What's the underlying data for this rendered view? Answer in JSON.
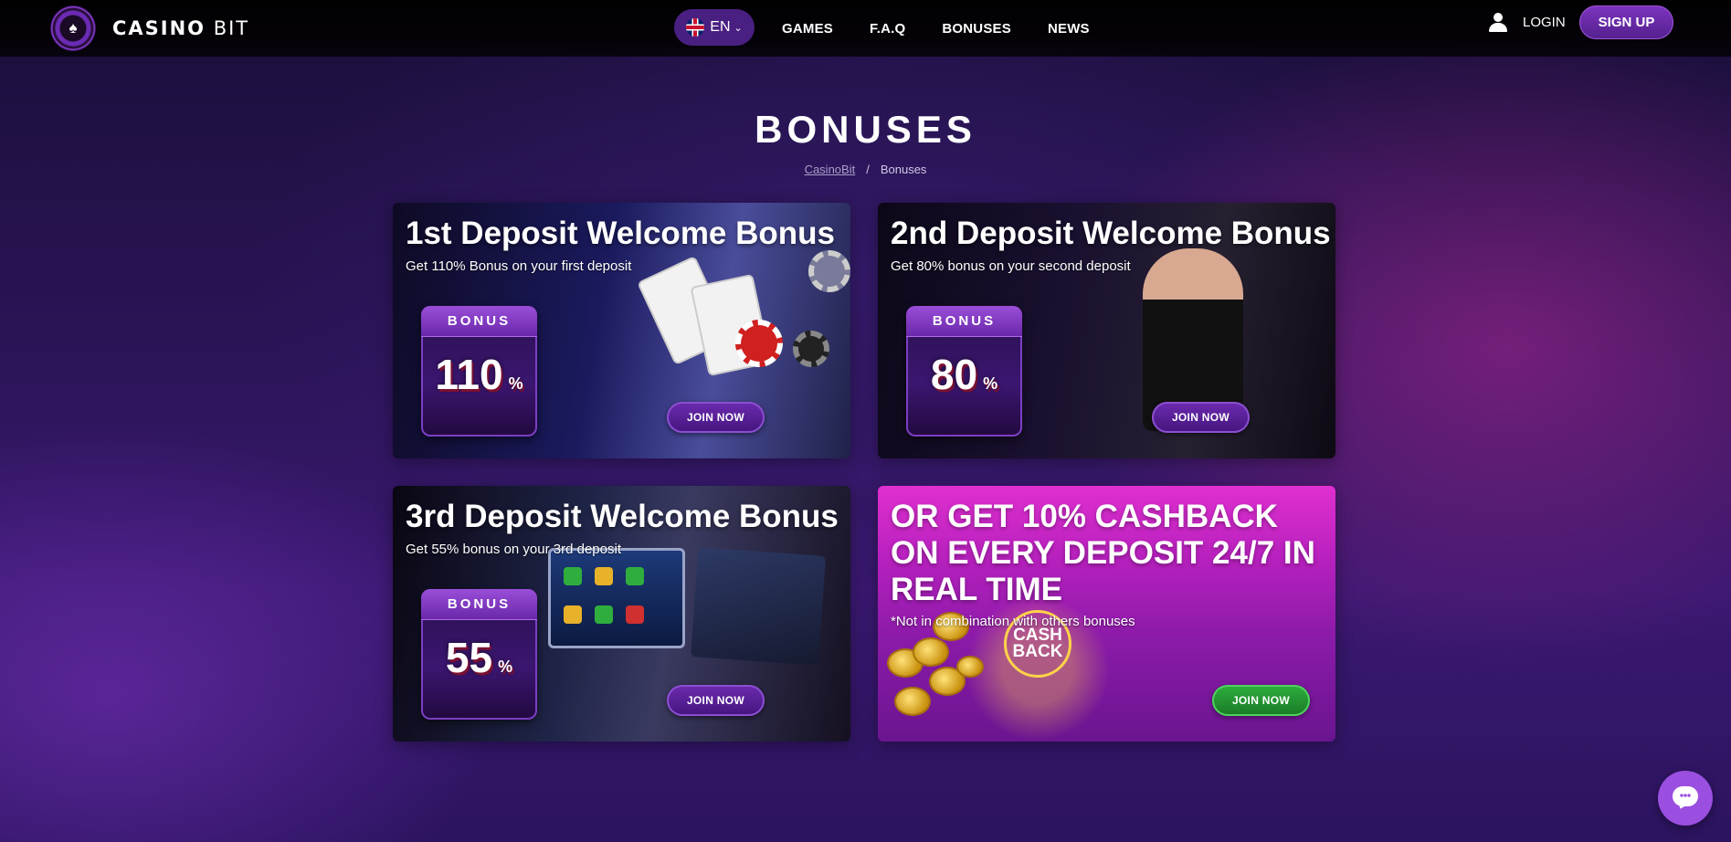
{
  "header": {
    "logo_text_bold": "CASINO",
    "logo_text_rest": " BIT",
    "language": "EN",
    "nav": [
      {
        "label": "GAMES"
      },
      {
        "label": "F.A.Q"
      },
      {
        "label": "BONUSES"
      },
      {
        "label": "NEWS"
      }
    ],
    "login_label": "LOGIN",
    "signup_label": "SIGN UP"
  },
  "page": {
    "title": "BONUSES",
    "breadcrumb": {
      "home": "CasinoBit",
      "separator": "/",
      "current": "Bonuses"
    }
  },
  "cards": [
    {
      "title": "1st Deposit Welcome Bonus",
      "subtitle": "Get 110% Bonus on your first deposit",
      "badge_label": "BONUS",
      "badge_value": "110",
      "badge_unit": "%",
      "cta": "JOIN NOW"
    },
    {
      "title": "2nd Deposit Welcome Bonus",
      "subtitle": "Get 80% bonus on your second deposit",
      "badge_label": "BONUS",
      "badge_value": "80",
      "badge_unit": "%",
      "cta": "JOIN NOW"
    },
    {
      "title": "3rd Deposit Welcome Bonus",
      "subtitle": "Get 55% bonus on your 3rd deposit",
      "badge_label": "BONUS",
      "badge_value": "55",
      "badge_unit": "%",
      "cta": "JOIN NOW"
    },
    {
      "title": "OR GET 10% CASHBACK ON EVERY DEPOSIT 24/7 IN REAL TIME",
      "subtitle": "*Not in combination with others bonuses",
      "art_line1": "CASH",
      "art_line2": "BACK",
      "cta": "JOIN NOW"
    }
  ],
  "colors": {
    "accent_purple": "#6d2bb0",
    "cashback_magenta": "#e02fd0",
    "cta_green": "#2fae3e",
    "chat_button": "#9b4fe0"
  },
  "icons": {
    "logo": "spade-icon",
    "language_flag": "uk-flag-icon",
    "user": "user-icon",
    "chat": "chat-icon"
  }
}
